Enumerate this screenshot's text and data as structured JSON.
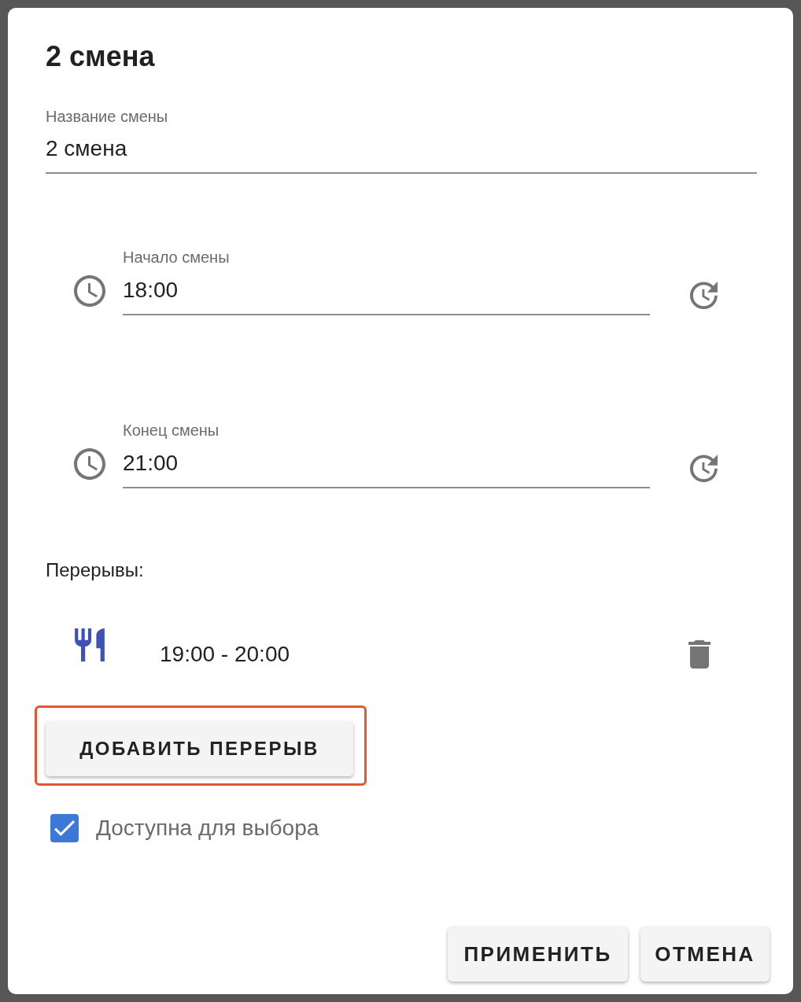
{
  "dialog": {
    "title": "2 смена"
  },
  "name_field": {
    "label": "Название смены",
    "value": "2 смена"
  },
  "time_fields": [
    {
      "label": "Начало смены",
      "value": "18:00"
    },
    {
      "label": "Конец смены",
      "value": "21:00"
    }
  ],
  "breaks": {
    "heading": "Перерывы:",
    "items": [
      {
        "time": "19:00 - 20:00"
      }
    ]
  },
  "add_break_button": {
    "label": "ДОБАВИТЬ ПЕРЕРЫВ",
    "highlighted": true
  },
  "available_checkbox": {
    "label": "Доступна для выбора",
    "checked": true
  },
  "buttons": [
    {
      "label": "ПРИМЕНИТЬ"
    },
    {
      "label": "ОТМЕНА"
    }
  ]
}
